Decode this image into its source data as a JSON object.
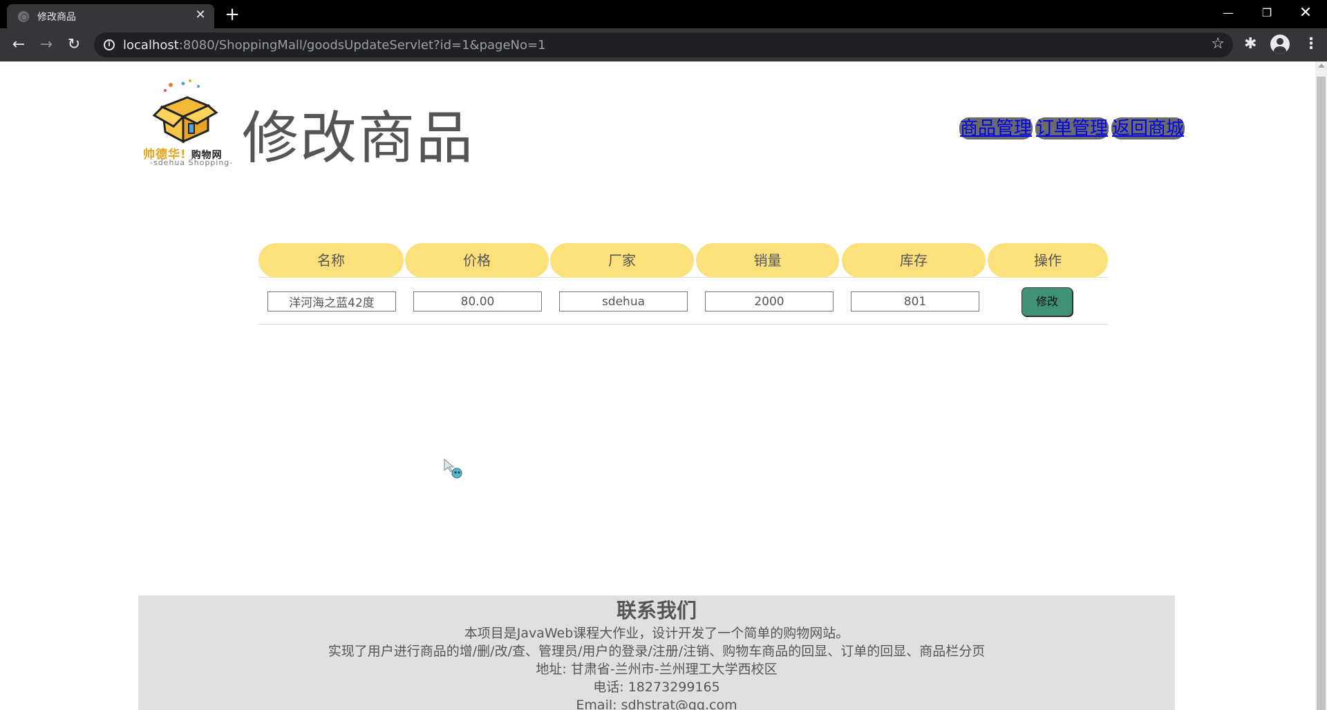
{
  "browser": {
    "tab_title": "修改商品",
    "url_host": "localhost",
    "url_rest": ":8080/ShoppingMall/goodsUpdateServlet?id=1&pageNo=1"
  },
  "header": {
    "logo": {
      "brand": "帅德华!",
      "brand_suffix": "购物网",
      "subtitle": "-sdehua Shopping-"
    },
    "title": "修改商品",
    "nav": [
      "商品管理",
      "订单管理",
      "返回商城"
    ]
  },
  "table": {
    "columns": [
      "名称",
      "价格",
      "厂家",
      "销量",
      "库存",
      "操作"
    ],
    "row": {
      "name": "洋河海之蓝42度",
      "price": "80.00",
      "maker": "sdehua",
      "sales": "2000",
      "stock": "801",
      "action_label": "修改"
    }
  },
  "footer": {
    "title": "联系我们",
    "lines": [
      "本项目是JavaWeb课程大作业，设计开发了一个简单的购物网站。",
      "实现了用户进行商品的增/删/改/查、管理员/用户的登录/注册/注销、购物车商品的回显、订单的回显、商品栏分页",
      "地址: 甘肃省-兰州市-兰州理工大学西校区",
      "电话: 18273299165",
      "Email: sdhstrat@qq.com"
    ]
  },
  "colors": {
    "header_cell": "#fce07c",
    "modify_button": "#3f9178",
    "footer_bg": "#e0e0e0",
    "nav_link": "#0000ee"
  }
}
